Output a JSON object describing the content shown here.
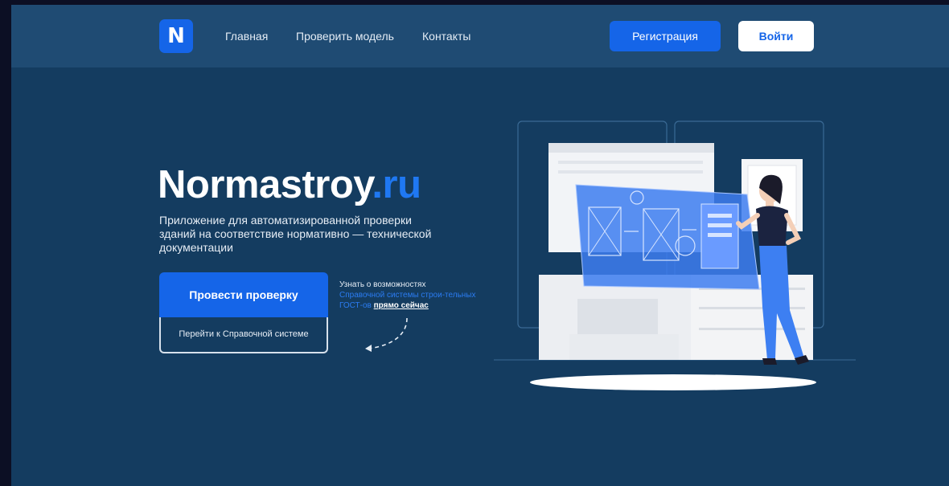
{
  "header": {
    "logo_letter": "N",
    "nav": [
      "Главная",
      "Проверить модель",
      "Контакты"
    ],
    "register_label": "Регистрация",
    "login_label": "Войти"
  },
  "hero": {
    "title_main": "Normastroy",
    "title_tld": ".ru",
    "description": "Приложение для автоматизированной проверки зданий на соответствие нормативно — технической документации",
    "primary_button": "Провести проверку",
    "secondary_button": "Перейти к Справочной системе",
    "note_prefix": "Узнать о  возможностях",
    "note_highlight": "Справочной системы строи-тельных ГОСТ-ов",
    "note_link": "прямо сейчас"
  },
  "colors": {
    "background": "#143c60",
    "header": "#1f4b73",
    "accent": "#1565e8"
  }
}
